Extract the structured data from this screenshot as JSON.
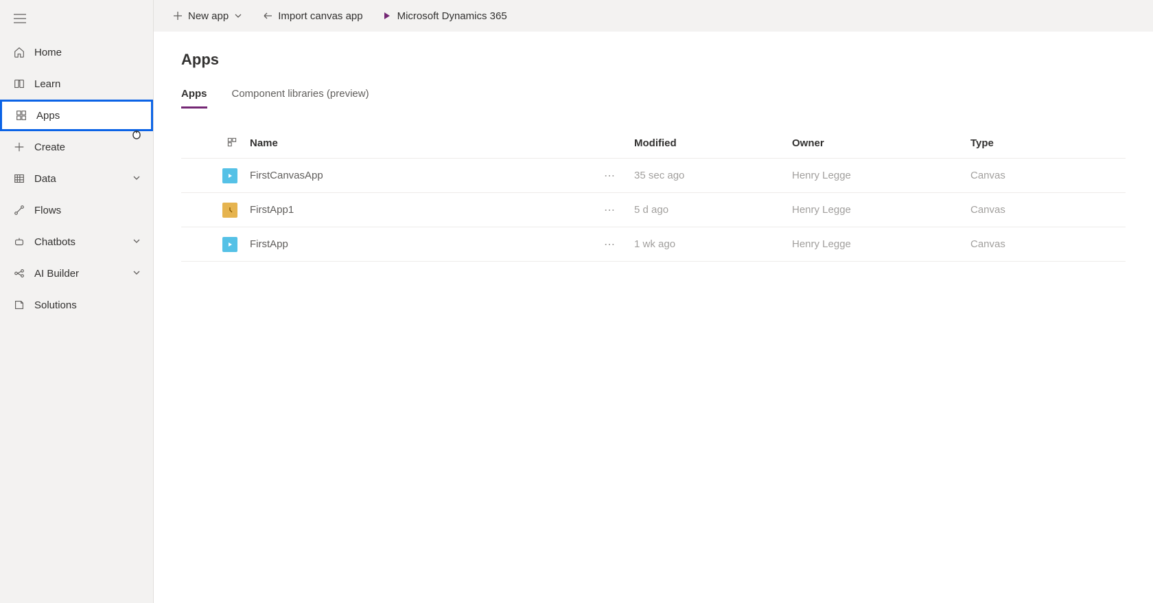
{
  "sidebar": {
    "items": [
      {
        "key": "home",
        "label": "Home"
      },
      {
        "key": "learn",
        "label": "Learn"
      },
      {
        "key": "apps",
        "label": "Apps"
      },
      {
        "key": "create",
        "label": "Create"
      },
      {
        "key": "data",
        "label": "Data"
      },
      {
        "key": "flows",
        "label": "Flows"
      },
      {
        "key": "chatbots",
        "label": "Chatbots"
      },
      {
        "key": "aibuilder",
        "label": "AI Builder"
      },
      {
        "key": "solutions",
        "label": "Solutions"
      }
    ]
  },
  "toolbar": {
    "new_app": "New app",
    "import": "Import canvas app",
    "dynamics": "Microsoft Dynamics 365"
  },
  "page": {
    "title": "Apps",
    "tabs": [
      {
        "label": "Apps",
        "active": true
      },
      {
        "label": "Component libraries (preview)",
        "active": false
      }
    ]
  },
  "table": {
    "columns": {
      "name": "Name",
      "modified": "Modified",
      "owner": "Owner",
      "type": "Type"
    },
    "rows": [
      {
        "icon": "canvas",
        "name": "FirstCanvasApp",
        "modified": "35 sec ago",
        "owner": "Henry Legge",
        "type": "Canvas"
      },
      {
        "icon": "model",
        "name": "FirstApp1",
        "modified": "5 d ago",
        "owner": "Henry Legge",
        "type": "Canvas"
      },
      {
        "icon": "canvas",
        "name": "FirstApp",
        "modified": "1 wk ago",
        "owner": "Henry Legge",
        "type": "Canvas"
      }
    ]
  }
}
